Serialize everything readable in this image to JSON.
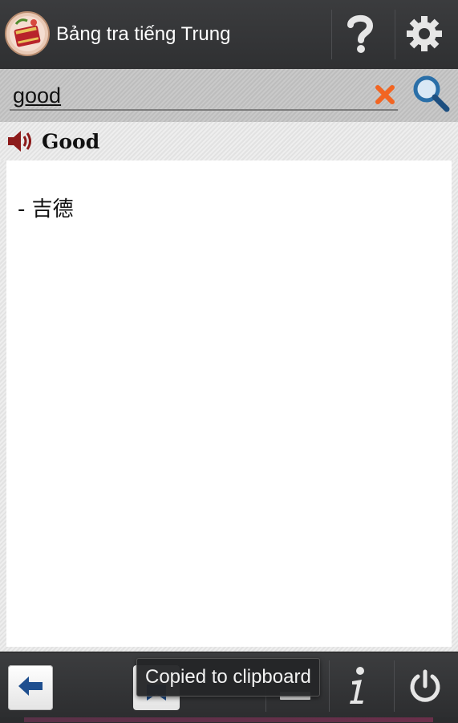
{
  "action_bar": {
    "title": "Bảng tra tiếng Trung",
    "app_icon": "dictionary-book-icon",
    "help_icon": "question-mark-icon",
    "settings_icon": "gear-icon"
  },
  "search": {
    "value": "good",
    "clear_icon": "close-x-icon",
    "search_icon": "magnifier-icon",
    "clear_color": "#f26522",
    "search_color": "#2a6fa8"
  },
  "entry": {
    "headword": "Good",
    "speaker_icon": "speaker-icon",
    "meaning": "- 吉德"
  },
  "toolbar": {
    "back_icon": "arrow-left-icon",
    "bookmark_icon": "bookmark-icon",
    "minus_icon": "minus-icon",
    "info_icon": "info-icon",
    "power_icon": "power-icon",
    "accent_blue": "#1f4f8f"
  },
  "toast": {
    "text": "Copied to clipboard"
  }
}
